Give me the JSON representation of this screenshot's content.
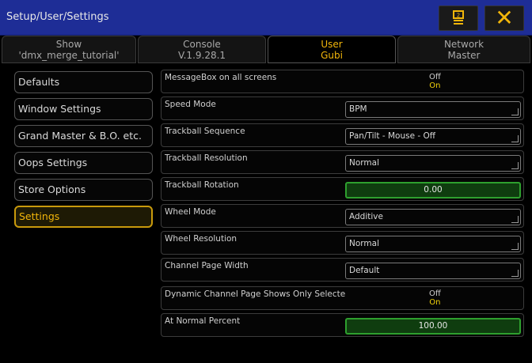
{
  "window": {
    "title": "Setup/User/Settings",
    "help_icon": "help-icon",
    "close_icon": "close-icon",
    "close_glyph": "✕"
  },
  "tabs": [
    {
      "line1": "Show",
      "line2": "'dmx_merge_tutorial'",
      "active": false
    },
    {
      "line1": "Console",
      "line2": "V.1.9.28.1",
      "active": false
    },
    {
      "line1": "User",
      "line2": "Gubi",
      "active": true
    },
    {
      "line1": "Network",
      "line2": "Master",
      "active": false
    }
  ],
  "menu": [
    {
      "label": "Defaults",
      "active": false
    },
    {
      "label": "Window Settings",
      "active": false
    },
    {
      "label": "Grand Master & B.O. etc.",
      "active": false
    },
    {
      "label": "Oops Settings",
      "active": false
    },
    {
      "label": "Store Options",
      "active": false
    },
    {
      "label": "Settings",
      "active": true
    }
  ],
  "settings": [
    {
      "label": "MessageBox on all screens",
      "type": "toggle",
      "off": "Off",
      "on": "On"
    },
    {
      "label": "Speed Mode",
      "type": "select",
      "value": "BPM"
    },
    {
      "label": "Trackball Sequence",
      "type": "select",
      "value": "Pan/Tilt - Mouse - Off"
    },
    {
      "label": "Trackball Resolution",
      "type": "select",
      "value": "Normal"
    },
    {
      "label": "Trackball Rotation",
      "type": "number",
      "value": "0.00"
    },
    {
      "label": "Wheel Mode",
      "type": "select",
      "value": "Additive"
    },
    {
      "label": "Wheel Resolution",
      "type": "select",
      "value": "Normal"
    },
    {
      "label": "Channel Page Width",
      "type": "select",
      "value": "Default"
    },
    {
      "label": "Dynamic Channel Page Shows Only Selectec",
      "type": "toggle",
      "off": "Off",
      "on": "On"
    },
    {
      "label": "At Normal Percent",
      "type": "number",
      "value": "100.00"
    }
  ],
  "colors": {
    "titlebar": "#1e2d96",
    "accent": "#f2b60a",
    "green_fill": "#0f3d0f",
    "green_border": "#2ea02e"
  }
}
